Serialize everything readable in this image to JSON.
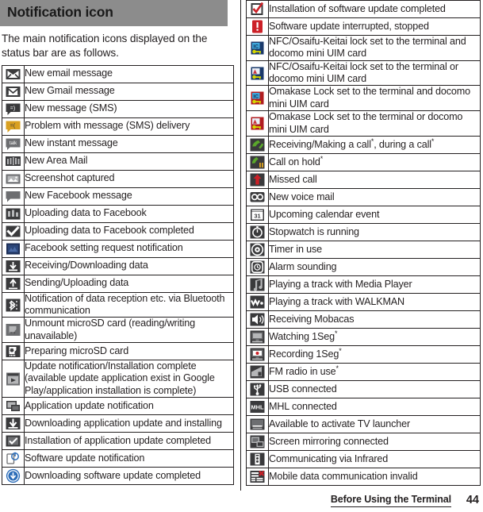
{
  "header": {
    "title": "Notification icon"
  },
  "intro": {
    "text": "The main notification icons displayed on the status bar are as follows."
  },
  "footer": {
    "chapter": "Before Using the Terminal",
    "page_number": "44"
  },
  "colors": {
    "header_background": "#8c8c8c",
    "text": "#231f20",
    "rule": "#231f20",
    "accent_red": "#cc2027",
    "accent_blue": "#2b6cb8",
    "accent_green": "#5aa72b",
    "accent_yellow": "#d9a021"
  },
  "left_table": {
    "rows": [
      {
        "icon": "new-email-message-icon",
        "label": "New email message"
      },
      {
        "icon": "new-gmail-message-icon",
        "label": "New Gmail message"
      },
      {
        "icon": "new-sms-message-icon",
        "label": "New message (SMS)"
      },
      {
        "icon": "sms-delivery-problem-icon",
        "label": "Problem with message (SMS) delivery"
      },
      {
        "icon": "new-instant-message-icon",
        "label": "New instant message"
      },
      {
        "icon": "new-area-mail-icon",
        "label": "New Area Mail"
      },
      {
        "icon": "screenshot-captured-icon",
        "label": "Screenshot captured"
      },
      {
        "icon": "new-facebook-message-icon",
        "label": "New Facebook message"
      },
      {
        "icon": "facebook-uploading-icon",
        "label": "Uploading data to Facebook"
      },
      {
        "icon": "facebook-upload-complete-icon",
        "label": "Uploading data to Facebook completed"
      },
      {
        "icon": "facebook-setting-request-icon",
        "label": "Facebook setting request notification"
      },
      {
        "icon": "downloading-data-icon",
        "label": "Receiving/Downloading data"
      },
      {
        "icon": "uploading-data-icon",
        "label": "Sending/Uploading data"
      },
      {
        "icon": "bluetooth-data-reception-icon",
        "label": "Notification of data reception etc. via Bluetooth communication"
      },
      {
        "icon": "unmount-microsd-icon",
        "label": "Unmount microSD card (reading/writing unavailable)"
      },
      {
        "icon": "preparing-microsd-icon",
        "label": "Preparing microSD card"
      },
      {
        "icon": "update-notification-icon",
        "label": "Update notification/Installation complete (available update application exist in Google Play/application installation is complete)"
      },
      {
        "icon": "application-update-notification-icon",
        "label": "Application update notification"
      },
      {
        "icon": "downloading-application-update-icon",
        "label": "Downloading application update and installing"
      },
      {
        "icon": "application-update-completed-icon",
        "label": "Installation of application update completed"
      },
      {
        "icon": "software-update-notification-icon",
        "label": "Software update notification"
      },
      {
        "icon": "software-update-downloaded-icon",
        "label": "Downloading software update completed"
      }
    ]
  },
  "right_table": {
    "rows": [
      {
        "icon": "software-update-installed-icon",
        "label": "Installation of software update completed",
        "asterisk": false
      },
      {
        "icon": "software-update-interrupted-icon",
        "label": "Software update interrupted, stopped",
        "asterisk": false
      },
      {
        "icon": "nfc-lock-terminal-and-uim-icon",
        "label": "NFC/Osaifu-Keitai lock set to the terminal and docomo mini UIM card",
        "asterisk": false
      },
      {
        "icon": "nfc-lock-terminal-or-uim-icon",
        "label": "NFC/Osaifu-Keitai lock set to the terminal or docomo mini UIM card",
        "asterisk": false
      },
      {
        "icon": "omakase-lock-and-uim-icon",
        "label": "Omakase Lock set to the terminal and docomo mini UIM card",
        "asterisk": false
      },
      {
        "icon": "omakase-lock-or-uim-icon",
        "label": "Omakase Lock set to the terminal or docomo mini UIM card",
        "asterisk": false
      },
      {
        "icon": "call-active-icon",
        "label": "Receiving/Making a call*, during a call*",
        "asterisk": false
      },
      {
        "icon": "call-on-hold-icon",
        "label": "Call on hold*",
        "asterisk": false
      },
      {
        "icon": "missed-call-icon",
        "label": "Missed call",
        "asterisk": false
      },
      {
        "icon": "new-voice-mail-icon",
        "label": "New voice mail",
        "asterisk": false
      },
      {
        "icon": "upcoming-calendar-event-icon",
        "label": "Upcoming calendar event",
        "asterisk": false
      },
      {
        "icon": "stopwatch-running-icon",
        "label": "Stopwatch is running",
        "asterisk": false
      },
      {
        "icon": "timer-in-use-icon",
        "label": "Timer in use",
        "asterisk": false
      },
      {
        "icon": "alarm-sounding-icon",
        "label": "Alarm sounding",
        "asterisk": false
      },
      {
        "icon": "media-player-playing-icon",
        "label": "Playing a track with Media Player",
        "asterisk": false
      },
      {
        "icon": "walkman-playing-icon",
        "label": "Playing a track with WALKMAN",
        "asterisk": false
      },
      {
        "icon": "receiving-mobacas-icon",
        "label": "Receiving Mobacas",
        "asterisk": false
      },
      {
        "icon": "watching-1seg-icon",
        "label": "Watching 1Seg*",
        "asterisk": false
      },
      {
        "icon": "recording-1seg-icon",
        "label": "Recording 1Seg*",
        "asterisk": false
      },
      {
        "icon": "fm-radio-in-use-icon",
        "label": "FM radio in use*",
        "asterisk": false
      },
      {
        "icon": "usb-connected-icon",
        "label": "USB connected",
        "asterisk": false
      },
      {
        "icon": "mhl-connected-icon",
        "label": "MHL connected",
        "asterisk": false
      },
      {
        "icon": "tv-launcher-available-icon",
        "label": "Available to activate TV launcher",
        "asterisk": false
      },
      {
        "icon": "screen-mirroring-connected-icon",
        "label": "Screen mirroring connected",
        "asterisk": false
      },
      {
        "icon": "infrared-communicating-icon",
        "label": "Communicating via Infrared",
        "asterisk": false
      },
      {
        "icon": "mobile-data-invalid-icon",
        "label": "Mobile data communication invalid",
        "asterisk": false
      }
    ]
  }
}
